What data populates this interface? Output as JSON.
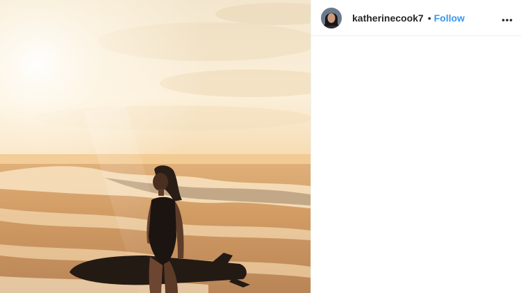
{
  "post": {
    "image": {
      "description_icon": "photo-surfer-at-sunset",
      "palette": {
        "sky": "#f6ecd6",
        "sun_glow": "#fff6e4",
        "sea": "#d7a46c",
        "foam": "#f8e4c4",
        "silhouette": "#241a14"
      }
    },
    "header": {
      "username": "katherinecook7",
      "separator": "•",
      "follow_label": "Follow",
      "follow_color": "#3897f0",
      "more_icon": "more-horizontal-icon",
      "avatar_icon": "avatar-icon"
    }
  }
}
